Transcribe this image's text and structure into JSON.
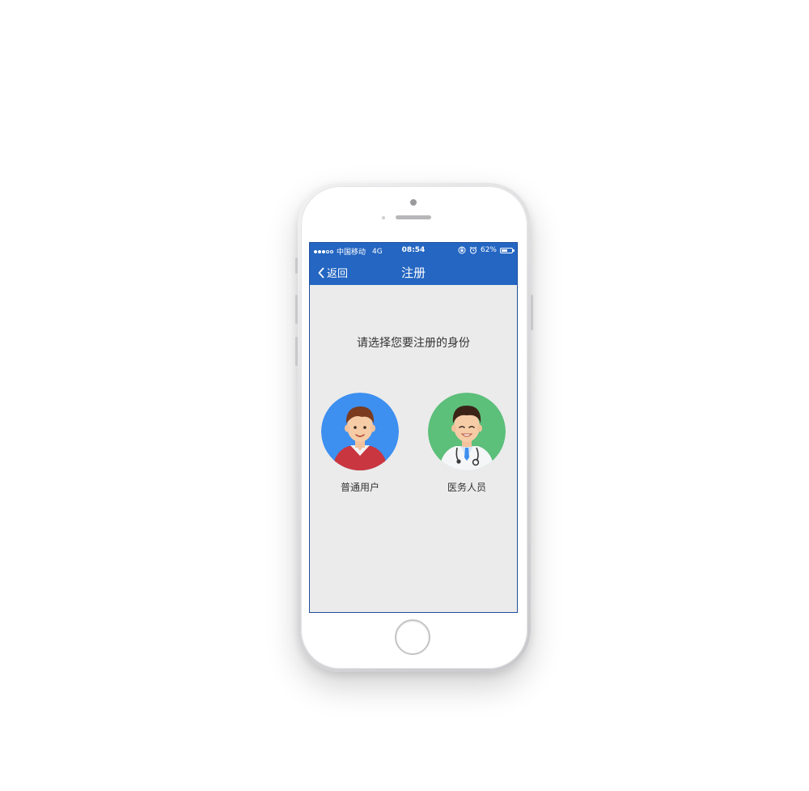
{
  "colors": {
    "nav_blue": "#2466c2",
    "screen_bg": "#ebebeb",
    "user_avatar_bg": "#3d8ff0",
    "medic_avatar_bg": "#5cbf7a"
  },
  "status_bar": {
    "carrier": "中国移动",
    "network": "4G",
    "time": "08:54",
    "battery": "62%",
    "battery_level": 0.62,
    "icons": [
      "signal-dots-icon",
      "rotation-lock-icon",
      "alarm-icon",
      "battery-icon"
    ]
  },
  "nav": {
    "back_label": "返回",
    "title": "注册",
    "back_icon": "chevron-left-icon"
  },
  "main": {
    "prompt": "请选择您要注册的身份",
    "roles": [
      {
        "label": "普通用户",
        "icon": "user-avatar-icon"
      },
      {
        "label": "医务人员",
        "icon": "doctor-avatar-icon"
      }
    ]
  }
}
